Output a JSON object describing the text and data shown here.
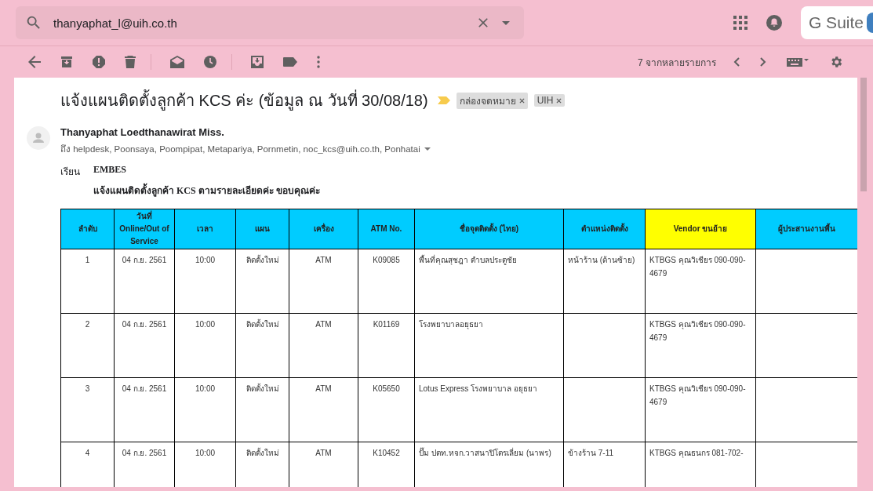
{
  "search": {
    "value": "thanyaphat_l@uih.co.th"
  },
  "brand": {
    "label": "G Suite"
  },
  "toolbar": {
    "count": "7 จากหลายรายการ"
  },
  "email": {
    "subject": "แจ้งแผนติดตั้งลูกค้า KCS ค่ะ (ข้อมูล ณ วันที่ 30/08/18)",
    "labels": [
      "กล่องจดหมาย",
      "UIH"
    ],
    "sender": "Thanyaphat Loedthanawirat Miss.",
    "recipients": "ถึง helpdesk, Poonsaya, Poompipat, Metapariya, Pornmetin, noc_kcs@uih.co.th, Ponhatai",
    "salutation": "เรียน",
    "addressee": "EMBES",
    "message": "แจ้งแผนติดตั้งลูกค้า KCS ตามรายละเอียดค่ะ ขอบคุณค่ะ"
  },
  "table": {
    "columns": [
      {
        "label": "ลำดับ",
        "color": "#00ccff"
      },
      {
        "label": "วันที่ Online/Out of Service",
        "color": "#00ccff"
      },
      {
        "label": "เวลา",
        "color": "#00ccff"
      },
      {
        "label": "แผน",
        "color": "#00ccff"
      },
      {
        "label": "เครื่อง",
        "color": "#00ccff"
      },
      {
        "label": "ATM No.",
        "color": "#00ccff"
      },
      {
        "label": "ชื่อจุดติดตั้ง (ไทย)",
        "color": "#00ccff"
      },
      {
        "label": "ตำแหน่งติดตั้ง",
        "color": "#00ccff"
      },
      {
        "label": "Vendor ขนย้าย",
        "color": "#ffff00"
      },
      {
        "label": "ผู้ประสานงานพื้น",
        "color": "#00ccff"
      }
    ],
    "rows": [
      [
        "1",
        "04 ก.ย. 2561",
        "10:00",
        "ติดตั้งใหม่",
        "ATM",
        "K09085",
        "พื้นที่คุณสุชฎา ตำบลประตูชัย",
        "หน้าร้าน (ด้านซ้าย)",
        "KTBGS คุณวิเชียร 090-090-4679",
        ""
      ],
      [
        "2",
        "04 ก.ย. 2561",
        "10:00",
        "ติดตั้งใหม่",
        "ATM",
        "K01169",
        "โรงพยาบาลอยุธยา",
        "",
        "KTBGS คุณวิเชียร 090-090-4679",
        ""
      ],
      [
        "3",
        "04 ก.ย. 2561",
        "10:00",
        "ติดตั้งใหม่",
        "ATM",
        "K05650",
        "Lotus Express โรงพยาบาล อยุธยา",
        "",
        "KTBGS คุณวิเชียร 090-090-4679",
        ""
      ],
      [
        "4",
        "04 ก.ย. 2561",
        "10:00",
        "ติดตั้งใหม่",
        "ATM",
        "K10452",
        "ปั๊ม ปตท.หจก.วาสนาปิโตรเลี่ยม (นาพร)",
        "ข้างร้าน 7-11",
        "KTBGS คุณธนกร 081-702-",
        ""
      ]
    ]
  }
}
